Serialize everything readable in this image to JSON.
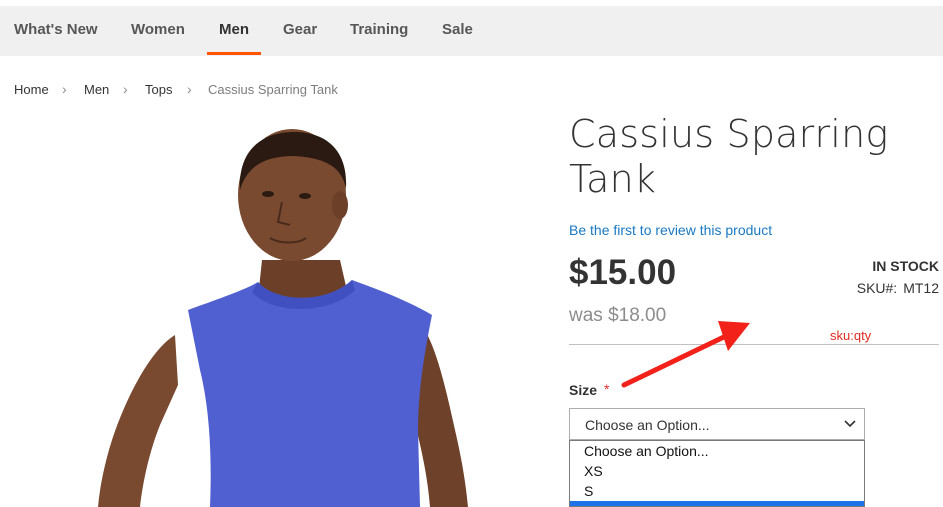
{
  "nav": {
    "items": [
      {
        "label": "What's New"
      },
      {
        "label": "Women"
      },
      {
        "label": "Men"
      },
      {
        "label": "Gear"
      },
      {
        "label": "Training"
      },
      {
        "label": "Sale"
      }
    ],
    "active": "Men",
    "accent_color": "#ff5501"
  },
  "breadcrumb": {
    "items": [
      "Home",
      "Men",
      "Tops",
      "Cassius Sparring Tank"
    ],
    "separator": "›"
  },
  "product": {
    "title": "Cassius Sparring Tank",
    "review_link": "Be the first to review this product",
    "price": "$15.00",
    "old_price": "was $18.00",
    "stock": "IN STOCK",
    "sku_label": "SKU#:",
    "sku_value": "MT12",
    "shirt_color": "#5060d0"
  },
  "annotation": {
    "text": "sku:qty",
    "color": "#e02b20"
  },
  "options": {
    "size_label": "Size",
    "required_mark": "*",
    "selected": "Choose an Option...",
    "list": [
      "Choose an Option...",
      "XS",
      "S"
    ],
    "highlight_color": "#1e73e8"
  },
  "icons": {
    "select_chevron": "chevron-down-icon",
    "annotation_arrow": "red-arrow-icon"
  }
}
